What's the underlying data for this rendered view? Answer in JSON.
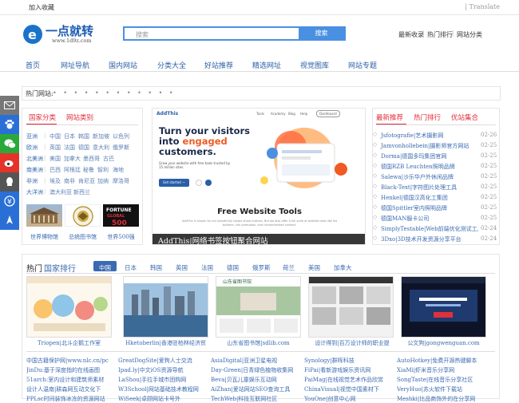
{
  "topbar": {
    "favorite": "加入收藏",
    "translate": "Translate"
  },
  "brand": {
    "name": "一点就转",
    "url": "www.1d9z.com"
  },
  "search": {
    "placeholder": "搜索",
    "button": "搜索"
  },
  "header_links": [
    "最新收录",
    "热门排行",
    "网站分类"
  ],
  "nav": [
    "首页",
    "网址导航",
    "国内网站",
    "分类大全",
    "好站推荐",
    "精选网址",
    "视觉图库",
    "网站专题"
  ],
  "hot_sites": {
    "label": "热门网站:",
    "dots": "• • • • • • • • • • • •"
  },
  "sidebar_icons": [
    "mail-icon",
    "paw-icon",
    "wechat-icon",
    "weibo-icon",
    "qq-icon",
    "money-icon",
    "moon-icon"
  ],
  "country_panel": {
    "tabs": [
      "国家分类",
      "网站类别"
    ],
    "regions": [
      {
        "name": "亚洲",
        "items": [
          "中国",
          "日本",
          "韩国",
          "新加坡",
          "以色列"
        ]
      },
      {
        "name": "欧洲",
        "items": [
          "英国",
          "法国",
          "德国",
          "意大利",
          "俄罗斯"
        ]
      },
      {
        "name": "北美洲",
        "items": [
          "美国",
          "加拿大",
          "墨西哥",
          "古巴"
        ]
      },
      {
        "name": "南美洲",
        "items": [
          "巴西",
          "阿根廷",
          "秘鲁",
          "智利",
          "海地"
        ]
      },
      {
        "name": "非洲",
        "items": [
          "埃及",
          "南非",
          "肯尼亚",
          "加纳",
          "摩洛哥"
        ]
      },
      {
        "name": "大洋洲",
        "items": [
          "澳大利亚",
          "新西兰"
        ]
      }
    ],
    "flags": [
      "世界博物馆",
      "总统图书馆",
      "世界500强"
    ]
  },
  "banner": {
    "brand": "AddThis",
    "nav": [
      "Tools",
      "Academy",
      "Blog",
      "Help",
      "Dashboard"
    ],
    "headline1": "Turn your visitors",
    "headline2_plain": "into ",
    "headline2_accent": "engaged",
    "headline3": "customers.",
    "sub": "Grow your website with free tools trusted by 15 million sites.",
    "cta": "Get started —",
    "free_tools": "Free Website Tools",
    "free_sub": "AddThis is known for our beautifully simple share buttons. But we also offer a full suite of website tools like list builders, link promotion, and recommended content.",
    "caption": "AddThis|网络书签按钮聚合网站"
  },
  "news": {
    "tabs": [
      "最新推荐",
      "热门排行",
      "优站集合"
    ],
    "items": [
      {
        "title": "Jsfotografie|艺术摄影网",
        "date": "02-26"
      },
      {
        "title": "Jamvonhollebein|摄影师官方网站",
        "date": "02-25"
      },
      {
        "title": "Dorma|德国多玛集团官网",
        "date": "02-25"
      },
      {
        "title": "德国RZB Leuchten照明品牌",
        "date": "02-25"
      },
      {
        "title": "Salewa|沙乐华户外休闲品牌",
        "date": "02-25"
      },
      {
        "title": "Black-Text|字符图片处理工具",
        "date": "02-25"
      },
      {
        "title": "Henkel|德国汉高化工集团",
        "date": "02-25"
      },
      {
        "title": "德国Spittler室内照明品牌",
        "date": "02-25"
      },
      {
        "title": "德国MAN服卡公司",
        "date": "02-25"
      },
      {
        "title": "SimplyTestable|Web前端优化测试工具",
        "date": "02-24"
      },
      {
        "title": "3Dxo|3D技术开发资源分享平台",
        "date": "02-24"
      }
    ]
  },
  "ranking": {
    "title": "热门",
    "title_accent": "国家排行",
    "tabs": [
      "中国",
      "日本",
      "韩国",
      "英国",
      "法国",
      "德国",
      "俄罗斯",
      "荷兰",
      "美国",
      "加拿大"
    ],
    "thumbs": [
      "Triopen|北斗企鹅工作室",
      "Hketoberlin|香港驻柏林经济贸",
      "山东省图书馆|sdlib.com",
      "设计得到|百万设计师的职业提",
      "公文狗|gongwenguan.com"
    ],
    "lists": [
      [
        "中国古籍保护网|www.nlc.cn/pc",
        "JinDu:基于深度指的在线画图",
        "51arch:室内设计和建筑师素材",
        "设计人温南|耕森网互动文化下",
        "PPLsc时间装饰冰冻的资源网站"
      ],
      [
        "GreatDogSite|爱狗人士交流",
        "Ipad.ly|中文iOS资源导航",
        "LaShou|手拉手城市团购网",
        "W3School|网站基础技术教程网",
        "WiSeek|卓顾网站卡号外"
      ],
      [
        "AsiaDigital|亚洲卫星电视",
        "Day-Green|日青绿色植物收集网",
        "Beva|贝瓦儿童娱乐互动网",
        "AiZhan|爱站网站SEO查询工具",
        "TechWeb|科技互联网社区"
      ],
      [
        "Synology|群晖科技",
        "FiPai|看新游戏娱乐资讯网",
        "PaiMag|在线视觉艺术作品欣赏",
        "ChinaVisual|视觉中国素材下",
        "YouOne|创意中心网"
      ],
      [
        "AutoHotkey|免费开源热键脚本",
        "XiaMi|虾米音乐分享网",
        "SongTaste|在线音乐分享社区",
        "VeryHuo|苏火软件下载站",
        "Meshki|比品商饰外的在分享网"
      ]
    ]
  }
}
